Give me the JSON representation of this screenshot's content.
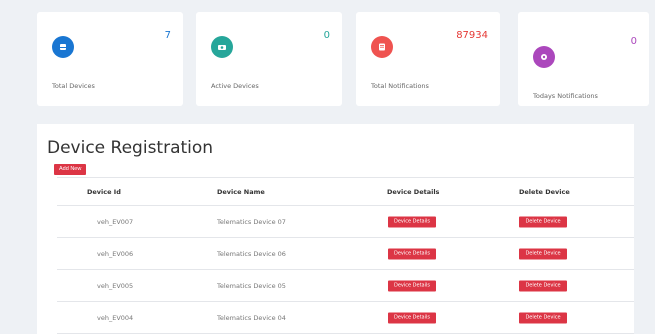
{
  "stats": [
    {
      "label": "Total Devices",
      "value": "7",
      "color": "#1976d2",
      "value_color": "#1976d2",
      "icon": "device-icon"
    },
    {
      "label": "Active Devices",
      "value": "0",
      "color": "#26a69a",
      "value_color": "#26a69a",
      "icon": "active-device-icon"
    },
    {
      "label": "Total Notifications",
      "value": "87934",
      "color": "#ef5350",
      "value_color": "#e53935",
      "icon": "notification-icon"
    },
    {
      "label": "Todays Notifications",
      "value": "0",
      "color": "#ab47bc",
      "value_color": "#ab47bc",
      "icon": "today-notification-icon"
    }
  ],
  "panel": {
    "title": "Device Registration",
    "add_button": "Add New"
  },
  "table": {
    "headers": [
      "Device Id",
      "Device Name",
      "Device Details",
      "Delete Device"
    ],
    "rows": [
      {
        "id": "veh_EV007",
        "name": "Telematics Device 07",
        "details": "Device Details",
        "delete": "Delete Device"
      },
      {
        "id": "veh_EV006",
        "name": "Telematics Device 06",
        "details": "Device Details",
        "delete": "Delete Device"
      },
      {
        "id": "veh_EV005",
        "name": "Telematics Device 05",
        "details": "Device Details",
        "delete": "Delete Device"
      },
      {
        "id": "veh_EV004",
        "name": "Telematics Device 04",
        "details": "Device Details",
        "delete": "Delete Device"
      }
    ]
  },
  "colors": {
    "accent_red": "#dc3545"
  }
}
